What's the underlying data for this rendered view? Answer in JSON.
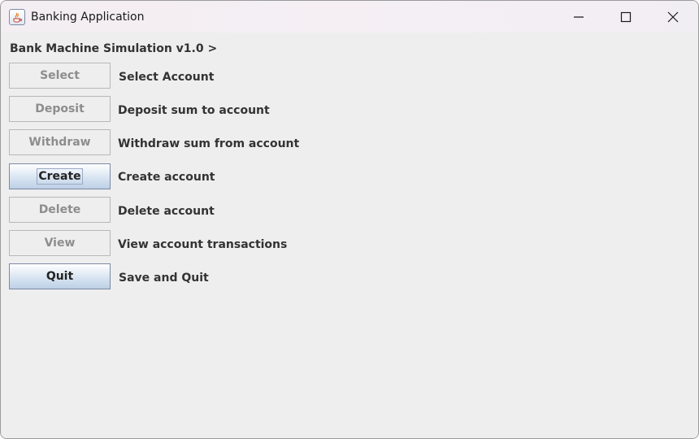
{
  "window": {
    "title": "Banking Application",
    "icons": {
      "app": "java-app-icon",
      "minimize": "minimize-icon",
      "maximize": "maximize-icon",
      "close": "close-icon"
    }
  },
  "main": {
    "heading": "Bank Machine Simulation v1.0 >",
    "select_button": "Select",
    "select_label": "Select Account",
    "deposit_button": "Deposit",
    "deposit_label": "Deposit sum to account",
    "withdraw_button": "Withdraw",
    "withdraw_label": "Withdraw sum from account",
    "create_button": "Create",
    "create_label": "Create account",
    "delete_button": "Delete",
    "delete_label": "Delete account",
    "view_button": "View",
    "view_label": "View account transactions",
    "quit_button": "Quit",
    "quit_label": "Save and Quit"
  },
  "colors": {
    "background": "#eeeeee",
    "disabled_text": "#8d8d8d",
    "enabled_button_top": "#ffffff",
    "enabled_button_bottom": "#bcd0e6"
  }
}
